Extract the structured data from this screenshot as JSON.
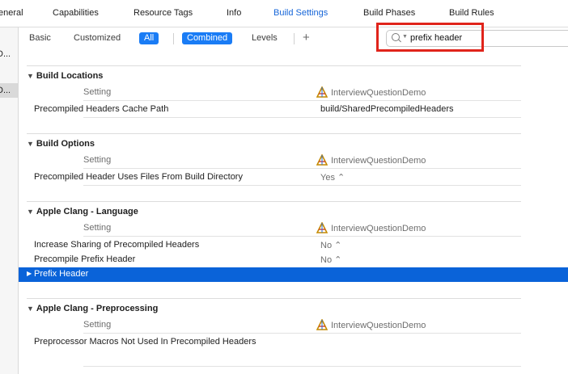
{
  "tabs": [
    "eneral",
    "Capabilities",
    "Resource Tags",
    "Info",
    "Build Settings",
    "Build Phases",
    "Build Rules"
  ],
  "sidebar": {
    "items": [
      "D...",
      "D..."
    ]
  },
  "filter": {
    "basic": "Basic",
    "customized": "Customized",
    "all": "All",
    "combined": "Combined",
    "levels": "Levels",
    "add": "+"
  },
  "search": {
    "value": "prefix header"
  },
  "columns": {
    "setting": "Setting",
    "target": "InterviewQuestionDemo"
  },
  "sections": [
    {
      "title": "Build Locations",
      "rows": [
        {
          "name": "Precompiled Headers Cache Path",
          "value": "build/SharedPrecompiledHeaders"
        }
      ]
    },
    {
      "title": "Build Options",
      "rows": [
        {
          "name": "Precompiled Header Uses Files From Build Directory",
          "value": "Yes ⌃"
        }
      ]
    },
    {
      "title": "Apple Clang - Language",
      "rows": [
        {
          "name": "Increase Sharing of Precompiled Headers",
          "value": "No ⌃"
        },
        {
          "name": "Precompile Prefix Header",
          "value": "No ⌃"
        },
        {
          "name": "Prefix Header",
          "value": ""
        }
      ]
    },
    {
      "title": "Apple Clang - Preprocessing",
      "rows": [
        {
          "name": "Preprocessor Macros Not Used In Precompiled Headers",
          "value": ""
        }
      ]
    }
  ],
  "colors": {
    "accent": "#1a7cf5",
    "selected_row": "#0a63d9",
    "highlight_box": "#e0241b"
  }
}
